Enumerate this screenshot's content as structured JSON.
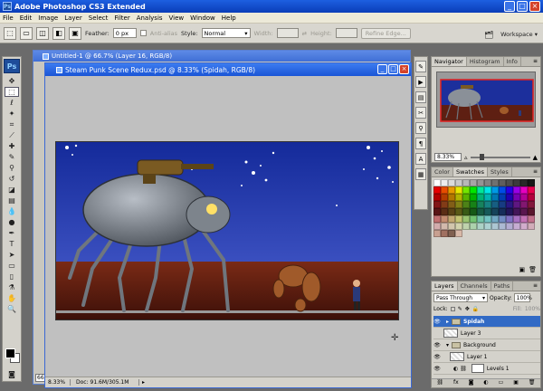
{
  "app": {
    "title": "Adobe Photoshop CS3 Extended",
    "logo": "Ps"
  },
  "window_controls": {
    "minimize": "_",
    "maximize": "□",
    "close": "×"
  },
  "menu": [
    "File",
    "Edit",
    "Image",
    "Layer",
    "Select",
    "Filter",
    "Analysis",
    "View",
    "Window",
    "Help"
  ],
  "options": {
    "feather_label": "Feather:",
    "feather_value": "0 px",
    "antialias_label": "Anti-alias",
    "style_label": "Style:",
    "style_value": "Normal",
    "width_label": "Width:",
    "height_label": "Height:",
    "refine_label": "Refine Edge...",
    "workspace_label": "Workspace ▾"
  },
  "documents": {
    "back": {
      "title": "Untitled-1 @ 66.7% (Layer 16, RGB/8)",
      "zoom": "66.7"
    },
    "front": {
      "title": "Steam Punk Scene Redux.psd @ 8.33% (Spidah, RGB/8)",
      "zoom": "8.33%",
      "doc_info": "Doc: 91.6M/305.1M"
    }
  },
  "navigator": {
    "tabs": [
      "Navigator",
      "Histogram",
      "Info"
    ],
    "zoom": "8.33%"
  },
  "swatches": {
    "tabs": [
      "Color",
      "Swatches",
      "Styles"
    ]
  },
  "layers_panel": {
    "tabs": [
      "Layers",
      "Channels",
      "Paths"
    ],
    "blend_mode": "Pass Through",
    "opacity_label": "Opacity:",
    "opacity_value": "100%",
    "lock_label": "Lock:",
    "fill_label": "Fill:",
    "fill_value": "100%",
    "layers": [
      {
        "name": "Spidah",
        "type": "group",
        "selected": true
      },
      {
        "name": "Layer 3",
        "type": "layer",
        "selected": false
      },
      {
        "name": "Background",
        "type": "group",
        "selected": false
      },
      {
        "name": "Layer 1",
        "type": "layer",
        "selected": false
      },
      {
        "name": "Levels 1",
        "type": "adjustment",
        "selected": false
      }
    ]
  },
  "colors": {
    "title_bar": "#1d5fe0",
    "selection": "#316ac5",
    "sky": "#1c2f9c",
    "ground": "#5e1f12"
  }
}
